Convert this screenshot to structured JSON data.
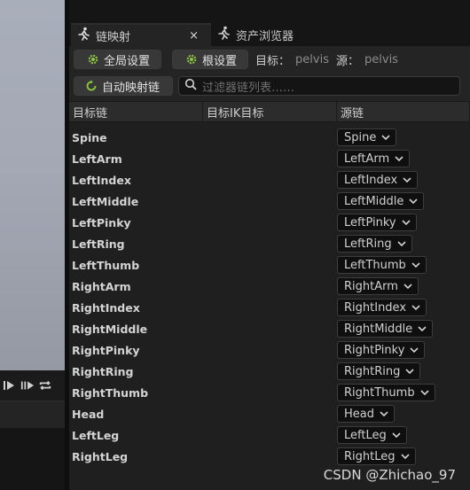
{
  "tabs": {
    "retarget": {
      "label": "链映射",
      "close": "×"
    },
    "asset_browser": {
      "label": "资产浏览器"
    }
  },
  "toolbar": {
    "global_settings": "全局设置",
    "root_settings": "根设置",
    "target_label": "目标：",
    "target_value": "pelvis",
    "source_label": "源：",
    "source_value": "pelvis",
    "auto_map": "自动映射链",
    "filter_placeholder": "过滤器链列表……"
  },
  "columns": {
    "target_chain": "目标链",
    "target_ik_goal": "目标IK目标",
    "source_chain": "源链"
  },
  "chains": [
    {
      "target": "Spine",
      "source": "Spine"
    },
    {
      "target": "LeftArm",
      "source": "LeftArm"
    },
    {
      "target": "LeftIndex",
      "source": "LeftIndex"
    },
    {
      "target": "LeftMiddle",
      "source": "LeftMiddle"
    },
    {
      "target": "LeftPinky",
      "source": "LeftPinky"
    },
    {
      "target": "LeftRing",
      "source": "LeftRing"
    },
    {
      "target": "LeftThumb",
      "source": "LeftThumb"
    },
    {
      "target": "RightArm",
      "source": "RightArm"
    },
    {
      "target": "RightIndex",
      "source": "RightIndex"
    },
    {
      "target": "RightMiddle",
      "source": "RightMiddle"
    },
    {
      "target": "RightPinky",
      "source": "RightPinky"
    },
    {
      "target": "RightRing",
      "source": "RightRing"
    },
    {
      "target": "RightThumb",
      "source": "RightThumb"
    },
    {
      "target": "Head",
      "source": "Head"
    },
    {
      "target": "LeftLeg",
      "source": "LeftLeg"
    },
    {
      "target": "RightLeg",
      "source": "RightLeg"
    }
  ],
  "watermark": "CSDN @Zhichao_97",
  "colors": {
    "gear_accent": "#8dc63f",
    "panel_bg": "#1f1f1f",
    "dropdown_bg": "#0f0f0f"
  }
}
